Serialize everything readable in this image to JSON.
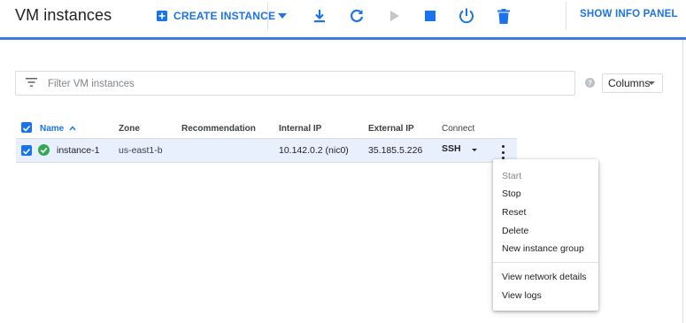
{
  "header": {
    "title": "VM instances",
    "create_label": "CREATE INSTANCE",
    "show_info_label": "SHOW INFO PANEL"
  },
  "filter": {
    "placeholder": "Filter VM instances",
    "value": "",
    "columns_label": "Columns"
  },
  "table": {
    "headers": {
      "name": "Name",
      "zone": "Zone",
      "recommendation": "Recommendation",
      "internal_ip": "Internal IP",
      "external_ip": "External IP",
      "connect": "Connect"
    },
    "rows": [
      {
        "name": "instance-1",
        "zone": "us-east1-b",
        "recommendation": "",
        "internal_ip": "10.142.0.2 (nic0)",
        "external_ip": "35.185.5.226",
        "connect": "SSH",
        "status": "running",
        "selected": true
      }
    ]
  },
  "menu": {
    "items": [
      "Start",
      "Stop",
      "Reset",
      "Delete",
      "New instance group",
      "View network details",
      "View logs"
    ],
    "disabled": [
      "Start"
    ]
  },
  "colors": {
    "accent": "#1a73e8",
    "header_line": "#3d7ce0",
    "row_selected": "#e8f0fe",
    "status_ok": "#34a853"
  },
  "icons": {
    "create": "add-box-icon",
    "more_actions": "caret-down-icon",
    "import": "download-icon",
    "refresh": "refresh-icon",
    "start": "play-icon",
    "stop": "stop-icon",
    "reset": "power-icon",
    "delete": "trash-icon",
    "filter": "filter-icon",
    "help": "help-icon",
    "status": "check-circle-icon",
    "row_menu": "more-vert-icon"
  }
}
